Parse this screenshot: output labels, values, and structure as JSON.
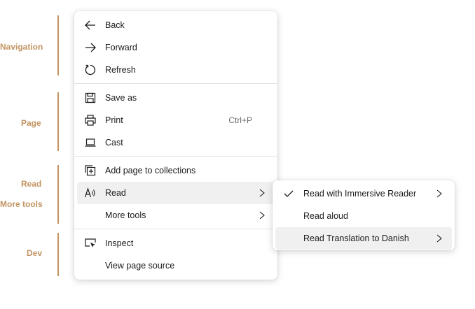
{
  "annotations": {
    "navigation": "Navigation",
    "page": "Page",
    "read": "Read",
    "more_tools": "More tools",
    "dev": "Dev"
  },
  "context_menu": {
    "back": "Back",
    "forward": "Forward",
    "refresh": "Refresh",
    "save_as": "Save as",
    "print": "Print",
    "print_shortcut": "Ctrl+P",
    "cast": "Cast",
    "add_page_to_collections": "Add page to collections",
    "read": "Read",
    "more_tools": "More tools",
    "inspect": "Inspect",
    "view_page_source": "View page source"
  },
  "read_submenu": {
    "immersive_reader": "Read with Immersive Reader",
    "read_aloud": "Read aloud",
    "translation": "Read Translation to Danish"
  },
  "colors": {
    "annotation": "#c39462",
    "highlight": "#f0f0f0"
  }
}
